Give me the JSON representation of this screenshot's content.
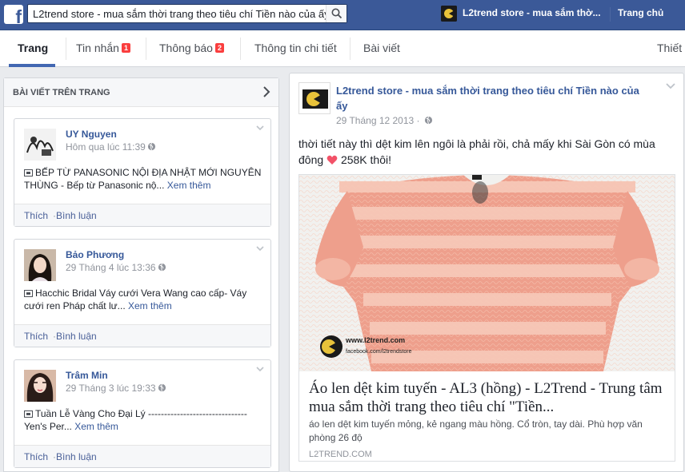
{
  "topbar": {
    "logo": "f",
    "search_value": "L2trend store - mua sắm thời trang theo tiêu chí Tiền nào của ấy",
    "page_name": "L2trend store - mua sắm thờ...",
    "home": "Trang chủ",
    "brand_color": "#3b5998"
  },
  "tabs": [
    {
      "label": "Trang",
      "active": true
    },
    {
      "label": "Tin nhắn",
      "badge": "1"
    },
    {
      "label": "Thông báo",
      "badge": "2"
    },
    {
      "label": "Thông tin chi tiết"
    },
    {
      "label": "Bài viết"
    },
    {
      "label": "Thiết"
    }
  ],
  "left_panel": {
    "title": "BÀI VIẾT TRÊN TRANG",
    "posts": [
      {
        "name": "UY Nguyen",
        "time": "Hôm qua lúc 11:39",
        "text": "BẾP TỪ PANASONIC NỘI ĐỊA NHẬT MỚI NGUYÊN THÙNG - Bếp từ Panasonic nộ...",
        "more": "Xem thêm",
        "like": "Thích",
        "comment": "Bình luận"
      },
      {
        "name": "Bảo Phương",
        "time": "29 Tháng 4 lúc 13:36",
        "text": "Hacchic Bridal Váy cưới Vera Wang cao cấp- Váy cưới ren Pháp chất lư...",
        "more": "Xem thêm",
        "like": "Thích",
        "comment": "Bình luận"
      },
      {
        "name": "Trâm Min",
        "time": "29 Tháng 3 lúc 19:33",
        "text": "Tuần Lễ Vàng Cho Đại Lý ------------------------------- Yen's Per...",
        "more": "Xem thêm",
        "like": "Thích",
        "comment": "Bình luận"
      }
    ]
  },
  "main_post": {
    "page_name": "L2trend store - mua sắm thời trang theo tiêu chí Tiền nào của ấy",
    "time": "29 Tháng 12 2013 ·",
    "text": "thời tiết này thì dệt kim lên ngôi là phải rồi, chả mấy khi Sài Gòn có mùa đông",
    "text_after": "258K thôi!",
    "watermark_url": "www.l2trend.com",
    "watermark_fb": "facebook.com/l2trendstore",
    "link_title": "Áo len dệt kim tuyến - AL3 (hồng) - L2Trend - Trung tâm mua sắm thời trang theo tiêu chí \"Tiền...",
    "link_desc": "áo len dệt kim tuyến mỏng, kẻ ngang màu hồng. Cổ tròn, tay dài. Phù hợp văn phòng 26 độ",
    "link_domain": "L2TREND.COM"
  }
}
